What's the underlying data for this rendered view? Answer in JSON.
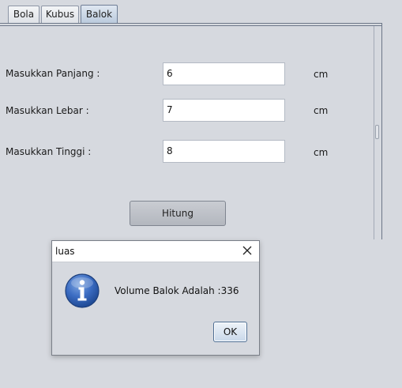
{
  "tabs": [
    {
      "label": "Bola"
    },
    {
      "label": "Kubus"
    },
    {
      "label": "Balok"
    }
  ],
  "form": {
    "panjang": {
      "label": "Masukkan Panjang :",
      "value": "6",
      "unit": "cm"
    },
    "lebar": {
      "label": "Masukkan Lebar :",
      "value": "7",
      "unit": "cm"
    },
    "tinggi": {
      "label": "Masukkan Tinggi :",
      "value": "8",
      "unit": "cm"
    },
    "hitung_label": "Hitung"
  },
  "dialog": {
    "title": "luas",
    "message": "Volume Balok Adalah :336",
    "ok_label": "OK",
    "icon": "info-icon"
  }
}
